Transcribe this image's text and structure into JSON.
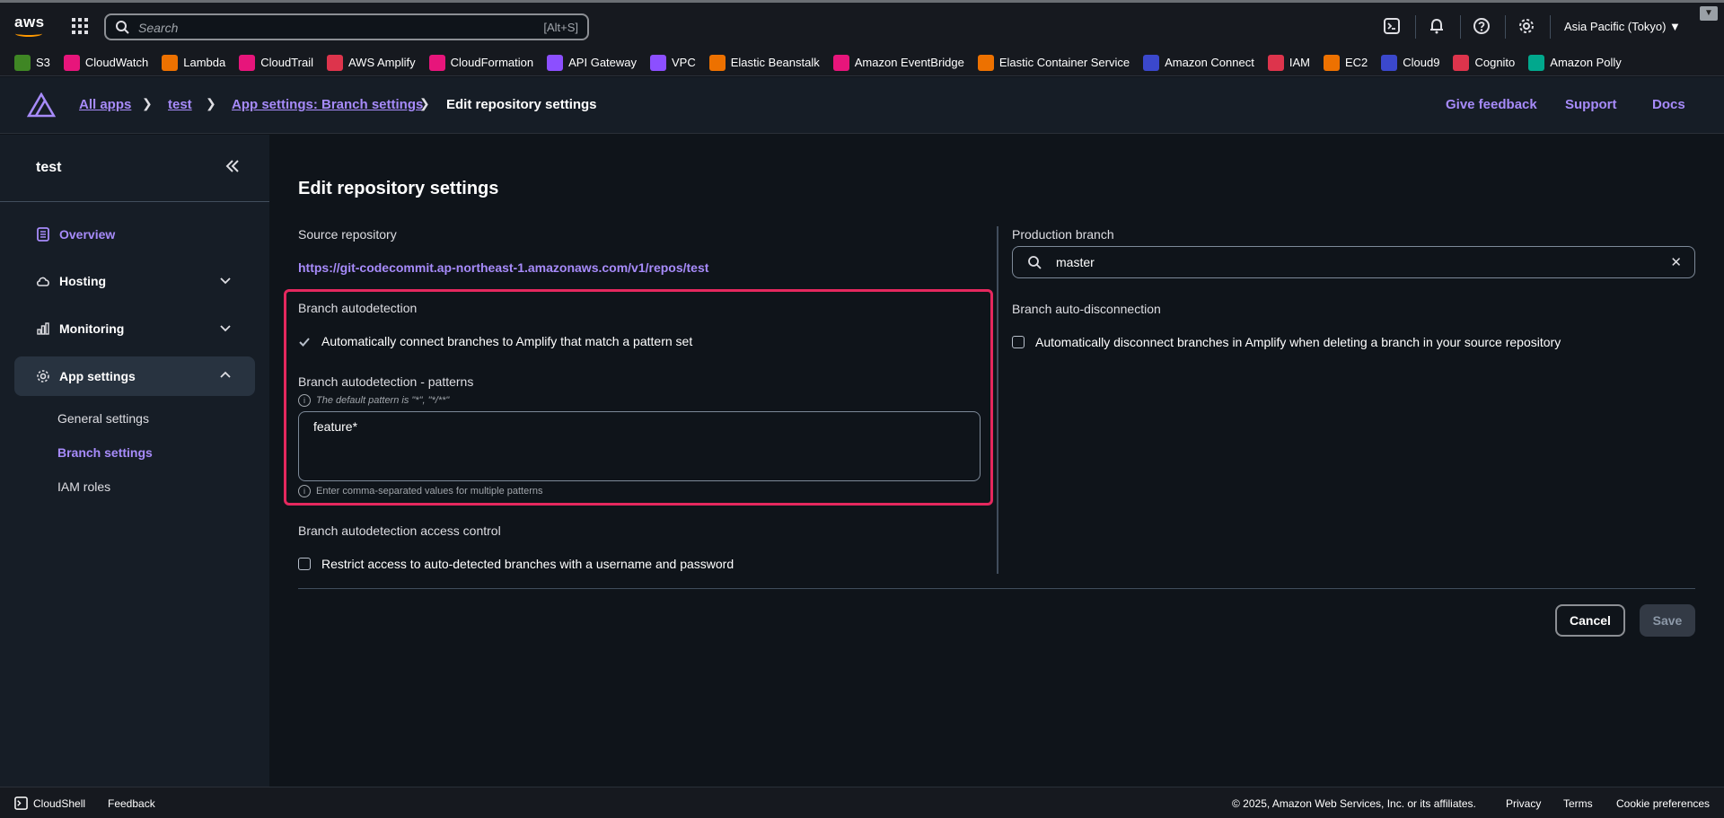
{
  "topbar": {
    "logo_text": "aws",
    "search_placeholder": "Search",
    "search_shortcut": "[Alt+S]",
    "region": "Asia Pacific (Tokyo) ▼"
  },
  "favorites": [
    {
      "label": "S3",
      "color": "#3f8624",
      "icon": "s3-icon"
    },
    {
      "label": "CloudWatch",
      "color": "#e7157b",
      "icon": "cloudwatch-icon"
    },
    {
      "label": "Lambda",
      "color": "#ed7100",
      "icon": "lambda-icon"
    },
    {
      "label": "CloudTrail",
      "color": "#e7157b",
      "icon": "cloudtrail-icon"
    },
    {
      "label": "AWS Amplify",
      "color": "#dd344c",
      "icon": "amplify-icon"
    },
    {
      "label": "CloudFormation",
      "color": "#e7157b",
      "icon": "cloudformation-icon"
    },
    {
      "label": "API Gateway",
      "color": "#8c4fff",
      "icon": "api-gateway-icon"
    },
    {
      "label": "VPC",
      "color": "#8c4fff",
      "icon": "vpc-icon"
    },
    {
      "label": "Elastic Beanstalk",
      "color": "#ed7100",
      "icon": "beanstalk-icon"
    },
    {
      "label": "Amazon EventBridge",
      "color": "#e7157b",
      "icon": "eventbridge-icon"
    },
    {
      "label": "Elastic Container Service",
      "color": "#ed7100",
      "icon": "ecs-icon"
    },
    {
      "label": "Amazon Connect",
      "color": "#3b48cc",
      "icon": "connect-icon"
    },
    {
      "label": "IAM",
      "color": "#dd344c",
      "icon": "iam-icon"
    },
    {
      "label": "EC2",
      "color": "#ed7100",
      "icon": "ec2-icon"
    },
    {
      "label": "Cloud9",
      "color": "#3b48cc",
      "icon": "cloud9-icon"
    },
    {
      "label": "Cognito",
      "color": "#dd344c",
      "icon": "cognito-icon"
    },
    {
      "label": "Amazon Polly",
      "color": "#01a88d",
      "icon": "polly-icon"
    }
  ],
  "breadcrumb": {
    "all_apps": "All apps",
    "app": "test",
    "settings": "App settings: Branch settings",
    "current": "Edit repository settings"
  },
  "header_links": {
    "feedback": "Give feedback",
    "support": "Support",
    "docs": "Docs"
  },
  "sidebar": {
    "title": "test",
    "overview": "Overview",
    "hosting": "Hosting",
    "monitoring": "Monitoring",
    "app_settings": "App settings",
    "sub": {
      "general": "General settings",
      "branch": "Branch settings",
      "iam": "IAM roles"
    }
  },
  "main": {
    "title": "Edit repository settings",
    "source_repo_label": "Source repository",
    "source_repo_url": "https://git-codecommit.ap-northeast-1.amazonaws.com/v1/repos/test",
    "autodetect_label": "Branch autodetection",
    "autodetect_checkbox": "Automatically connect branches to Amplify that match a pattern set",
    "patterns_label": "Branch autodetection - patterns",
    "patterns_hint": "The default pattern is \"*\", \"*/**\"",
    "patterns_value": "feature*",
    "patterns_help": "Enter comma-separated values for multiple patterns",
    "access_label": "Branch autodetection access control",
    "access_checkbox": "Restrict access to auto-detected branches with a username and password",
    "prod_label": "Production branch",
    "prod_value": "master",
    "disconnect_label": "Branch auto-disconnection",
    "disconnect_checkbox": "Automatically disconnect branches in Amplify when deleting a branch in your source repository",
    "cancel": "Cancel",
    "save": "Save"
  },
  "footer": {
    "cloudshell": "CloudShell",
    "feedback": "Feedback",
    "copyright": "© 2025, Amazon Web Services, Inc. or its affiliates.",
    "privacy": "Privacy",
    "terms": "Terms",
    "cookies": "Cookie preferences"
  }
}
